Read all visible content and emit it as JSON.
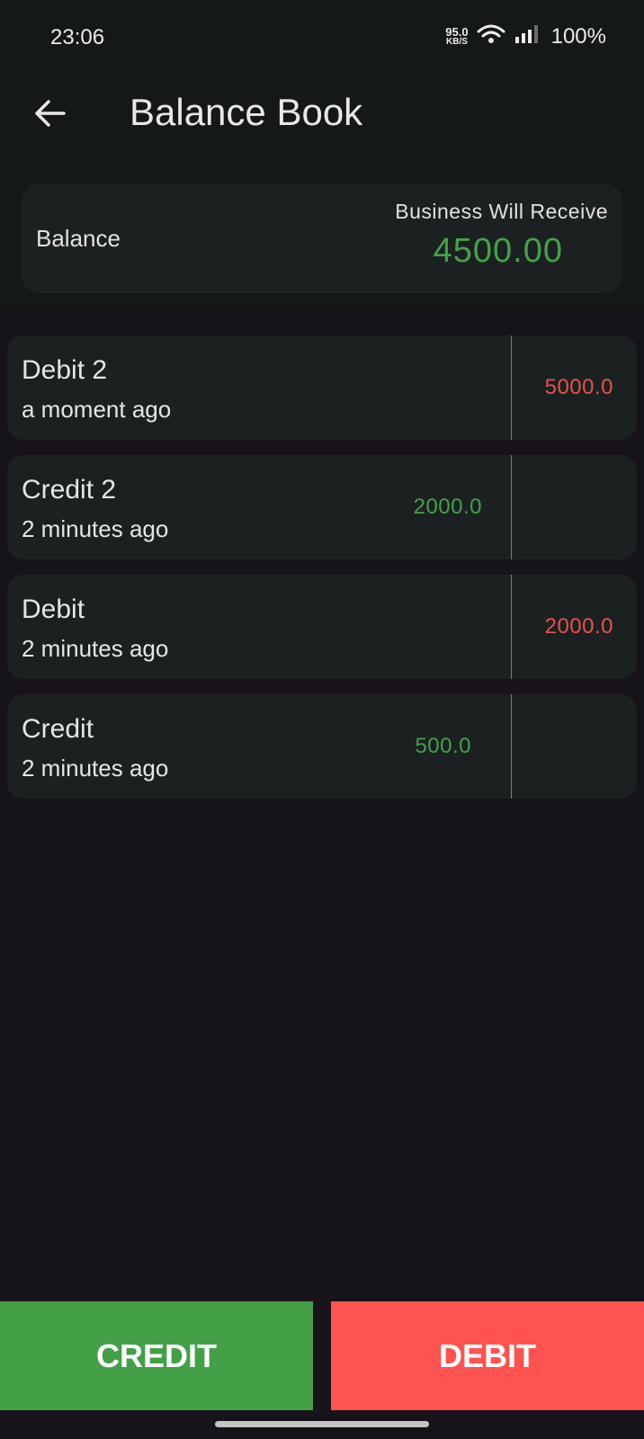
{
  "status_bar": {
    "time": "23:06",
    "net_speed_value": "95.0",
    "net_speed_unit": "KB/S",
    "battery": "100%",
    "icons": [
      "wifi-icon",
      "signal-icon"
    ]
  },
  "app_bar": {
    "back_icon": "arrow-left-icon",
    "title": "Balance Book"
  },
  "balance_card": {
    "label": "Balance",
    "receive_label": "Business Will Receive",
    "value": "4500.00"
  },
  "transactions": [
    {
      "title": "Debit 2",
      "time": "a moment ago",
      "credit": "",
      "debit": "5000.0"
    },
    {
      "title": "Credit 2",
      "time": "2 minutes ago",
      "credit": "2000.0",
      "debit": ""
    },
    {
      "title": "Debit",
      "time": "2 minutes ago",
      "credit": "",
      "debit": "2000.0"
    },
    {
      "title": "Credit",
      "time": "2 minutes ago",
      "credit": "500.0",
      "debit": ""
    }
  ],
  "actions": {
    "credit_label": "CREDIT",
    "debit_label": "DEBIT"
  },
  "colors": {
    "credit": "#43a047",
    "debit": "#fe5350",
    "credit_text": "#46a04a",
    "debit_text": "#e8504d",
    "card_background": "#1b2120",
    "page_background": "#16141a"
  }
}
